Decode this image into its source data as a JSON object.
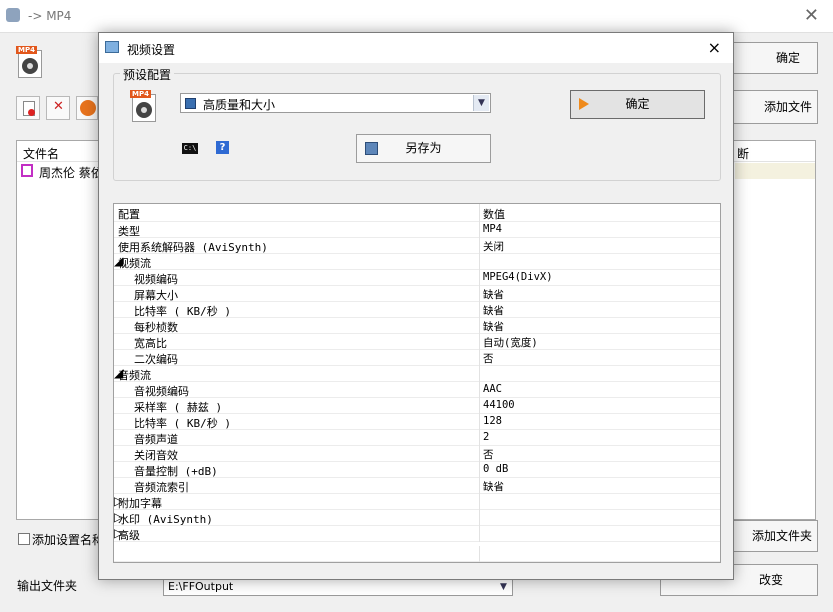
{
  "main_window": {
    "title": "-> MP4",
    "close_glyph": "✕",
    "ok_button": "确定",
    "add_file_button": "添加文件",
    "file_list_header_name": "文件名",
    "file_list_header_status": "断",
    "file_list_rows": [
      {
        "name": "周杰伦 蔡依"
      }
    ],
    "add_setting_checkbox": "添加设置名称",
    "add_folder_button": "添加文件夹",
    "output_folder_label": "输出文件夹",
    "output_folder_value": "E:\\FFOutput",
    "change_button": "改变",
    "mp4_badge": "MP4"
  },
  "dialog": {
    "title": "视频设置",
    "close_glyph": "×",
    "preset_group_label": "预设配置",
    "preset_select_value": "高质量和大小",
    "ok_button": "确定",
    "save_as_button": "另存为",
    "cmd_icon_text": "C:\\",
    "help_icon_text": "?",
    "mp4_badge": "MP4",
    "grid_header": {
      "key": "配置",
      "value": "数值"
    },
    "grid_rows": [
      {
        "type": "plain",
        "key": "类型",
        "value": "MP4"
      },
      {
        "type": "plain",
        "key": "使用系统解码器 (AviSynth)",
        "value": "关闭"
      },
      {
        "type": "category",
        "key": "视频流",
        "expand": "◢"
      },
      {
        "type": "item",
        "key": "视频编码",
        "value": "MPEG4(DivX)"
      },
      {
        "type": "item",
        "key": "屏幕大小",
        "value": "缺省"
      },
      {
        "type": "item",
        "key": "比特率 ( KB/秒 )",
        "value": "缺省"
      },
      {
        "type": "item",
        "key": "每秒桢数",
        "value": "缺省"
      },
      {
        "type": "item",
        "key": "宽高比",
        "value": "自动(宽度)"
      },
      {
        "type": "item",
        "key": "二次编码",
        "value": "否"
      },
      {
        "type": "category",
        "key": "音频流",
        "expand": "◢"
      },
      {
        "type": "item",
        "key": "音视频编码",
        "value": "AAC"
      },
      {
        "type": "item",
        "key": "采样率 ( 赫兹 )",
        "value": "44100"
      },
      {
        "type": "item",
        "key": "比特率 ( KB/秒 )",
        "value": "128"
      },
      {
        "type": "item",
        "key": "音频声道",
        "value": "2"
      },
      {
        "type": "item",
        "key": "关闭音效",
        "value": "否"
      },
      {
        "type": "item",
        "key": "音量控制 (+dB)",
        "value": "0 dB"
      },
      {
        "type": "item",
        "key": "音频流索引",
        "value": "缺省"
      },
      {
        "type": "category",
        "key": "附加字幕",
        "expand": "▷"
      },
      {
        "type": "category",
        "key": "水印 (AviSynth)",
        "expand": "▷"
      },
      {
        "type": "category",
        "key": "高级",
        "expand": "▷"
      }
    ]
  }
}
